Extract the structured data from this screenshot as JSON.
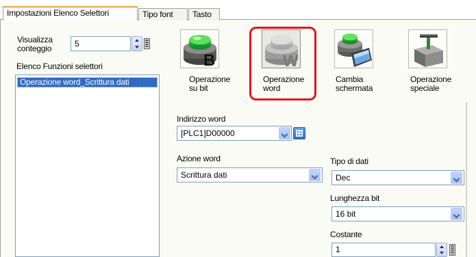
{
  "tabs": [
    {
      "label": "Impostazioni Elenco Selettori",
      "active": true
    },
    {
      "label": "Tipo font",
      "active": false
    },
    {
      "label": "Tasto",
      "active": false
    }
  ],
  "left": {
    "count_label": "Visualizza\nconteggio",
    "count_value": "5",
    "list_title": "Elenco Funzioni selettori",
    "list_items": [
      "Operazione word_Scrittura dati"
    ]
  },
  "operations": [
    {
      "icon": "button-bit-icon",
      "label": "Operazione\nsu bit",
      "letter": "B"
    },
    {
      "icon": "button-word-icon",
      "label": "Operazione\nword",
      "letter": "W",
      "selected": true
    },
    {
      "icon": "screen-change-icon",
      "label": "Cambia\nschermata"
    },
    {
      "icon": "special-operation-icon",
      "label": "Operazione\nspeciale"
    }
  ],
  "form": {
    "word_address_label": "Indirizzo word",
    "word_address_value": "[PLC1]D00000",
    "word_action_label": "Azione word",
    "word_action_value": "Scrittura dati",
    "data_type_label": "Tipo di dati",
    "data_type_value": "Dec",
    "bit_length_label": "Lunghezza bit",
    "bit_length_value": "16 bit",
    "constant_label": "Costante",
    "constant_value": "1"
  },
  "colors": {
    "highlight": "#e4141a",
    "selection": "#316ac5",
    "tab_accent": "#e8a33a"
  }
}
